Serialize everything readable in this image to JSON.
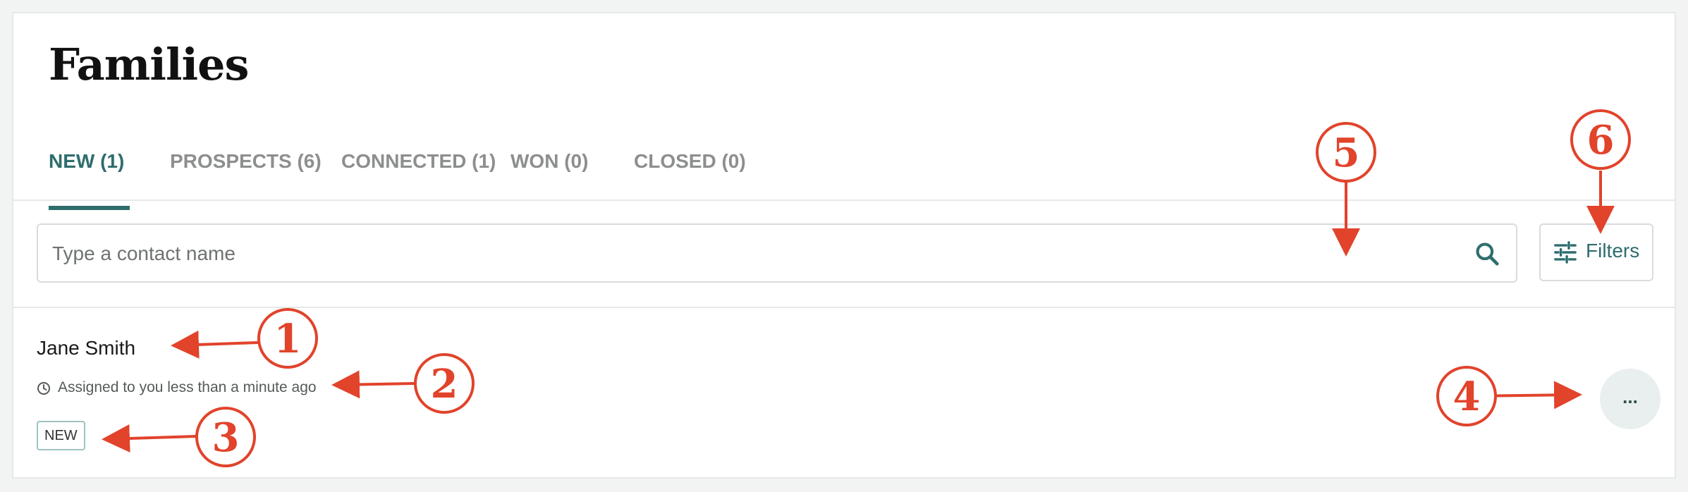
{
  "page": {
    "title": "Families"
  },
  "tabs": [
    {
      "label": "NEW  (1)",
      "active": true
    },
    {
      "label": "PROSPECTS (6)",
      "active": false
    },
    {
      "label": "CONNECTED (1)",
      "active": false
    },
    {
      "label": "WON (0)",
      "active": false
    },
    {
      "label": "CLOSED (0)",
      "active": false
    }
  ],
  "search": {
    "placeholder": "Type a contact name",
    "value": "",
    "icon": "search-icon"
  },
  "filters": {
    "label": "Filters",
    "icon": "sliders-icon"
  },
  "contacts": [
    {
      "name": "Jane Smith",
      "assigned": "Assigned to you less than a minute ago",
      "status": "NEW",
      "more_label": "..."
    }
  ],
  "annotations": [
    "1",
    "2",
    "3",
    "4",
    "5",
    "6"
  ],
  "colors": {
    "accent": "#2f6d6d",
    "annotation": "#e1432b",
    "more_button_bg": "#e8efee",
    "badge_border": "#9ec3c3"
  }
}
